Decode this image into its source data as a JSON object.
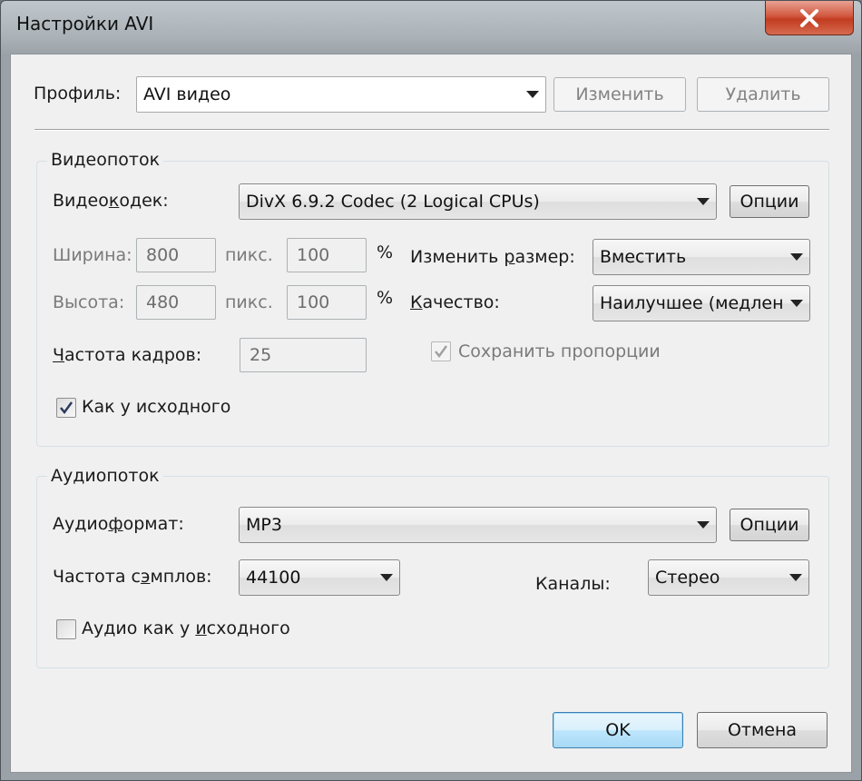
{
  "window": {
    "title": "Настройки AVI"
  },
  "profile": {
    "label": "Профиль:",
    "value": "AVI видео",
    "edit_button": "Изменить",
    "delete_button": "Удалить"
  },
  "video": {
    "group_title": "Видеопоток",
    "codec_label": "Видеокодек:",
    "codec_value": "DivX 6.9.2 Codec (2 Logical CPUs)",
    "codec_options_button": "Опции",
    "width_label": "Ширина:",
    "width_value": "800",
    "width_unit": "пикс.",
    "width_percent": "100",
    "height_label": "Высота:",
    "height_value": "480",
    "height_unit": "пикс.",
    "height_percent": "100",
    "percent_sign": "%",
    "resize_label": "Изменить размер:",
    "resize_value": "Вместить",
    "quality_label": "Качество:",
    "quality_value": "Наилучшее (медленн",
    "fps_label": "Частота кадров:",
    "fps_value": "25",
    "keep_aspect_label": "Сохранить пропорции",
    "keep_aspect_checked": true,
    "same_as_source_label": "Как у исходного",
    "same_as_source_checked": true
  },
  "audio": {
    "group_title": "Аудиопоток",
    "format_label": "Аудиоформат:",
    "format_value": "MP3",
    "format_options_button": "Опции",
    "sample_rate_label": "Частота сэмплов:",
    "sample_rate_value": "44100",
    "channels_label": "Каналы:",
    "channels_value": "Стерео",
    "same_as_source_label": "Аудио как у исходного",
    "same_as_source_checked": false
  },
  "footer": {
    "ok_button": "OK",
    "cancel_button": "Отмена"
  },
  "colors": {
    "close_button": "#c8452a",
    "ok_border": "#3c7fb1",
    "client_bg": "#f0f0f0"
  }
}
